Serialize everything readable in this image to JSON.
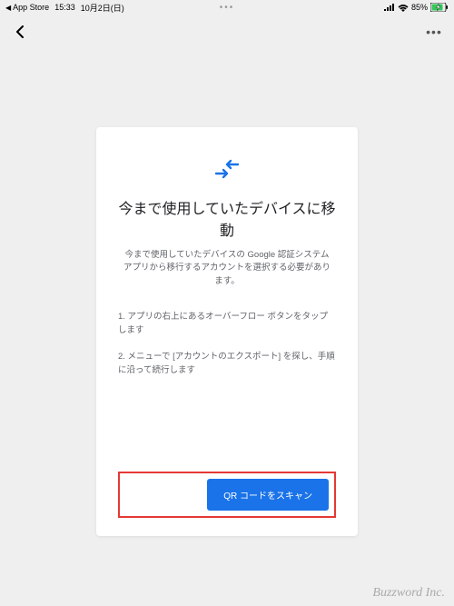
{
  "status": {
    "app_return": "App Store",
    "time": "15:33",
    "date": "10月2日(日)",
    "battery": "85%"
  },
  "card": {
    "title": "今まで使用していたデバイスに移動",
    "subtitle": "今まで使用していたデバイスの Google 認証システム アプリから移行するアカウントを選択する必要があります。",
    "step1": "1. アプリの右上にあるオーバーフロー ボタンをタップします",
    "step2": "2. メニューで [アカウントのエクスポート] を探し、手順に沿って続行します",
    "scan_button": "QR コードをスキャン"
  },
  "watermark": "Buzzword Inc."
}
